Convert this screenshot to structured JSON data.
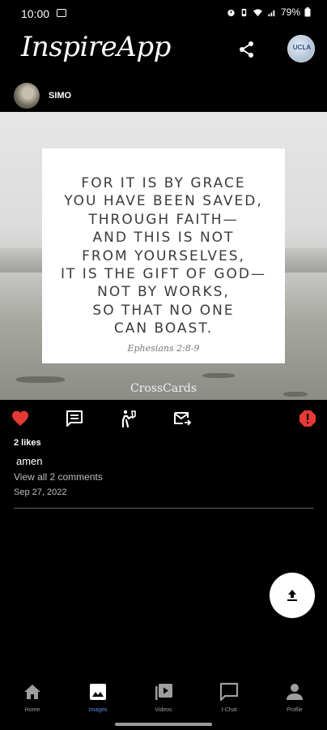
{
  "status_bar": {
    "time": "10:00",
    "battery": "79%"
  },
  "header": {
    "logo": "InspireApp",
    "avatar_text": "UCLA"
  },
  "post": {
    "username": "SIMO",
    "verse_lines": "FOR IT IS BY GRACE\nYOU HAVE BEEN SAVED,\nTHROUGH FAITH—\nAND THIS IS NOT\nFROM YOURSELVES,\nIT IS THE GIFT OF GOD—\nNOT BY WORKS,\nSO THAT NO ONE\nCAN BOAST.",
    "verse_reference": "Ephesians 2:8-9",
    "watermark": "CrossCards",
    "likes": "2 likes",
    "comment_text": "amen",
    "view_comments": "View all 2 comments",
    "date": "Sep 27, 2022"
  },
  "actions": {
    "like_icon": "heart-icon",
    "comment_icon": "comment-icon",
    "pray_icon": "pray-icon",
    "message_icon": "mail-forward-icon",
    "report_icon": "report-icon",
    "like_color": "#e53935",
    "report_color": "#e53935"
  },
  "nav": {
    "home": "Home",
    "images": "Images",
    "videos": "Videos",
    "ichat": "I-Chat",
    "profile": "Profile",
    "active_color": "#5c8fe0"
  }
}
